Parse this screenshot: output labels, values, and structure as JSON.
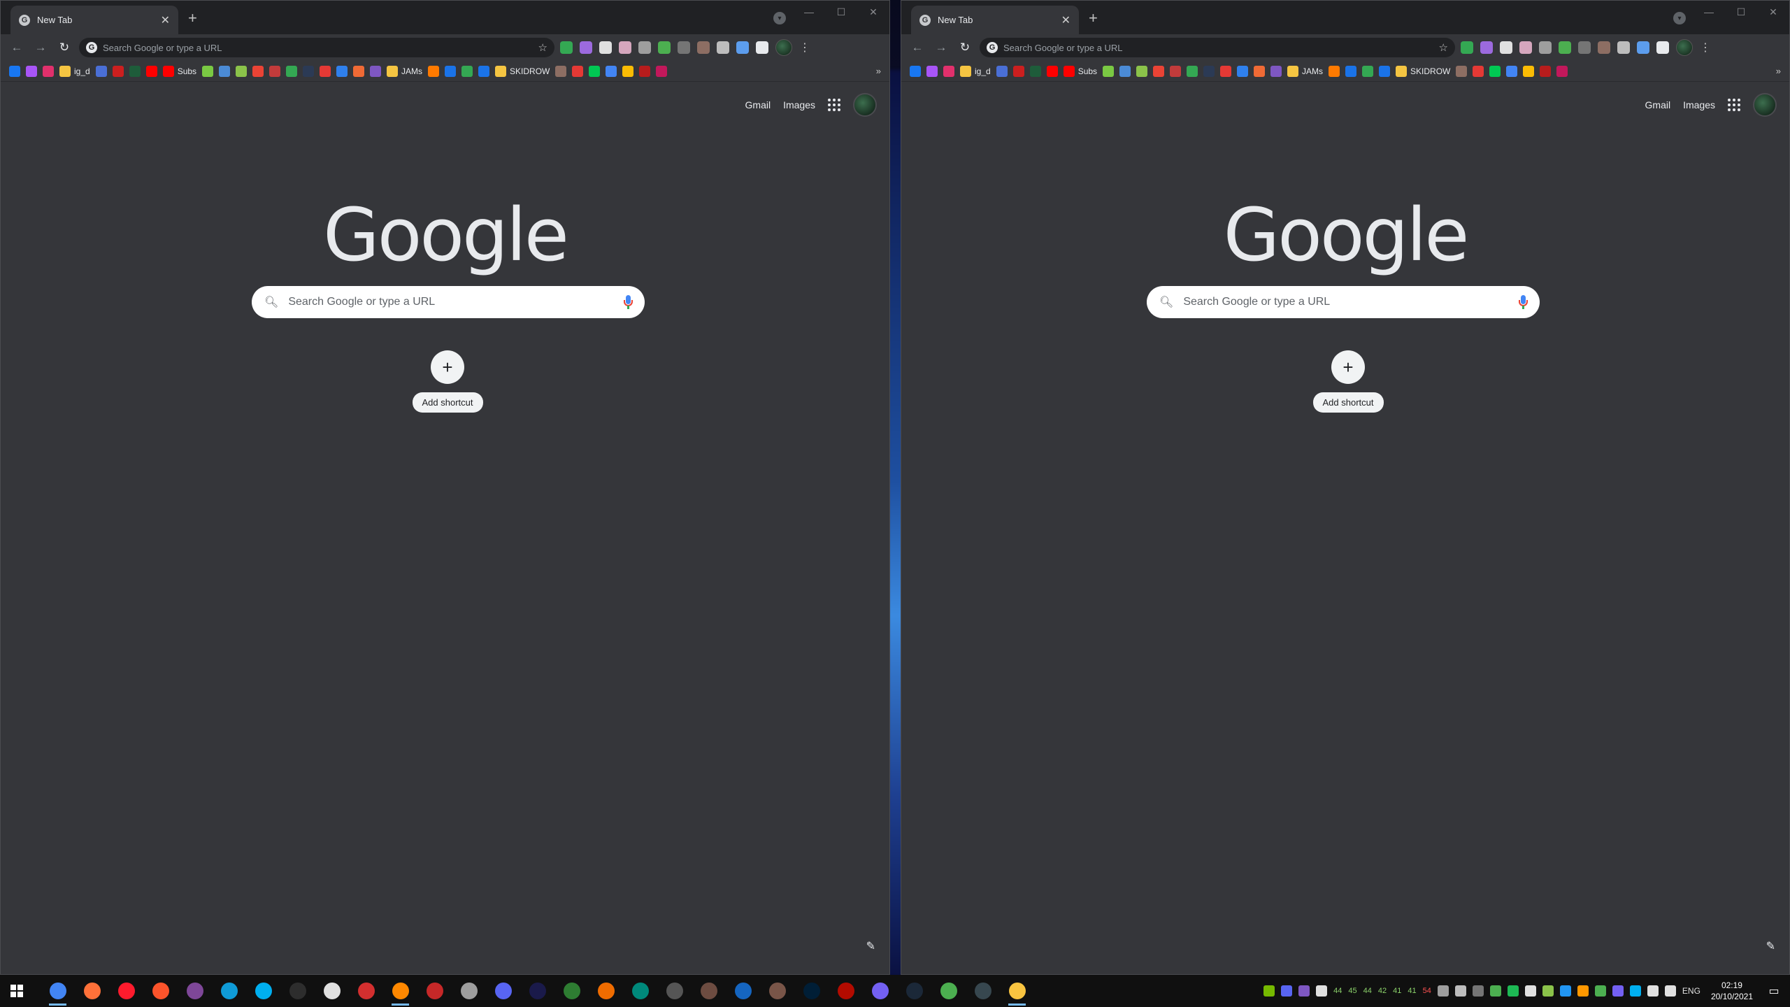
{
  "browser": {
    "tab_title": "New Tab",
    "omnibox_placeholder": "Search Google or type a URL",
    "bookmarks": [
      {
        "label": "",
        "color": "#1877f2"
      },
      {
        "label": "",
        "color": "#a855f7"
      },
      {
        "label": "",
        "color": "#e1306c"
      },
      {
        "label": "ig_d",
        "color": "#f5c542"
      },
      {
        "label": "",
        "color": "#4a6fd6"
      },
      {
        "label": "",
        "color": "#cc1f1f"
      },
      {
        "label": "",
        "color": "#1e5c3a"
      },
      {
        "label": "Subs",
        "color": "#ff0000"
      },
      {
        "label": "",
        "color": "#7ac943"
      },
      {
        "label": "",
        "color": "#4b8bd6"
      },
      {
        "label": "",
        "color": "#8bc34a"
      },
      {
        "label": "",
        "color": "#ea4335"
      },
      {
        "label": "",
        "color": "#c23b3b"
      },
      {
        "label": "",
        "color": "#34a853"
      },
      {
        "label": "",
        "color": "#2b3a55"
      },
      {
        "label": "",
        "color": "#e53935"
      },
      {
        "label": "",
        "color": "#2f80ed"
      },
      {
        "label": "",
        "color": "#f06a35"
      },
      {
        "label": "",
        "color": "#7e57c2"
      },
      {
        "label": "JAMs",
        "color": "#f5c542"
      },
      {
        "label": "",
        "color": "#ff7a00"
      },
      {
        "label": "",
        "color": "#1a73e8"
      },
      {
        "label": "",
        "color": "#34a853"
      },
      {
        "label": "SKIDROW",
        "color": "#f5c542"
      },
      {
        "label": "",
        "color": "#8d6e63"
      },
      {
        "label": "",
        "color": "#e53935"
      },
      {
        "label": "",
        "color": "#00c853"
      },
      {
        "label": "",
        "color": "#4285f4"
      },
      {
        "label": "",
        "color": "#fbbc04"
      },
      {
        "label": "",
        "color": "#b71c1c"
      },
      {
        "label": "",
        "color": "#c2185b"
      }
    ],
    "bookmarks_overflow": "»"
  },
  "ntp": {
    "gmail": "Gmail",
    "images": "Images",
    "logo": "Google",
    "search_placeholder": "Search Google or type a URL",
    "add_shortcut": "Add shortcut"
  },
  "taskbar": {
    "apps": [
      {
        "name": "chrome",
        "color": "#4285f4",
        "active": true
      },
      {
        "name": "firefox",
        "color": "#ff7139",
        "active": false
      },
      {
        "name": "opera",
        "color": "#ff1b2d",
        "active": false
      },
      {
        "name": "brave",
        "color": "#fb542b",
        "active": false
      },
      {
        "name": "tor",
        "color": "#7e4798",
        "active": false
      },
      {
        "name": "edge",
        "color": "#0f9bd7",
        "active": false
      },
      {
        "name": "skype",
        "color": "#00aff0",
        "active": false
      },
      {
        "name": "terminal",
        "color": "#2d2d2d",
        "active": false
      },
      {
        "name": "app-white",
        "color": "#e0e0e0",
        "active": false
      },
      {
        "name": "app-red",
        "color": "#d32f2f",
        "active": false
      },
      {
        "name": "vlc",
        "color": "#ff8800",
        "active": true
      },
      {
        "name": "app-s",
        "color": "#c62828",
        "active": false
      },
      {
        "name": "app-shield",
        "color": "#9e9e9e",
        "active": false
      },
      {
        "name": "discord",
        "color": "#5865f2",
        "active": false
      },
      {
        "name": "audition",
        "color": "#1a1a4a",
        "active": false
      },
      {
        "name": "app-green",
        "color": "#2e7d32",
        "active": false
      },
      {
        "name": "app-orange",
        "color": "#ef6c00",
        "active": false
      },
      {
        "name": "app-globe",
        "color": "#00897b",
        "active": false
      },
      {
        "name": "resolve",
        "color": "#555555",
        "active": false
      },
      {
        "name": "app-img",
        "color": "#6d4c41",
        "active": false
      },
      {
        "name": "app-blue-shield",
        "color": "#1565c0",
        "active": false
      },
      {
        "name": "app-figure",
        "color": "#795548",
        "active": false
      },
      {
        "name": "photoshop",
        "color": "#001e36",
        "active": false
      },
      {
        "name": "acrobat",
        "color": "#b30b00",
        "active": false
      },
      {
        "name": "viber",
        "color": "#7360f2",
        "active": false
      },
      {
        "name": "steam",
        "color": "#1b2838",
        "active": false
      },
      {
        "name": "utorrent",
        "color": "#4caf50",
        "active": false
      },
      {
        "name": "calculator",
        "color": "#37474f",
        "active": false
      },
      {
        "name": "explorer",
        "color": "#f9c440",
        "active": true
      }
    ],
    "tray_numbers": [
      "44",
      "45",
      "44",
      "42",
      "41",
      "41",
      "54"
    ],
    "language": "ENG",
    "time": "02:19",
    "date": "20/10/2021"
  }
}
